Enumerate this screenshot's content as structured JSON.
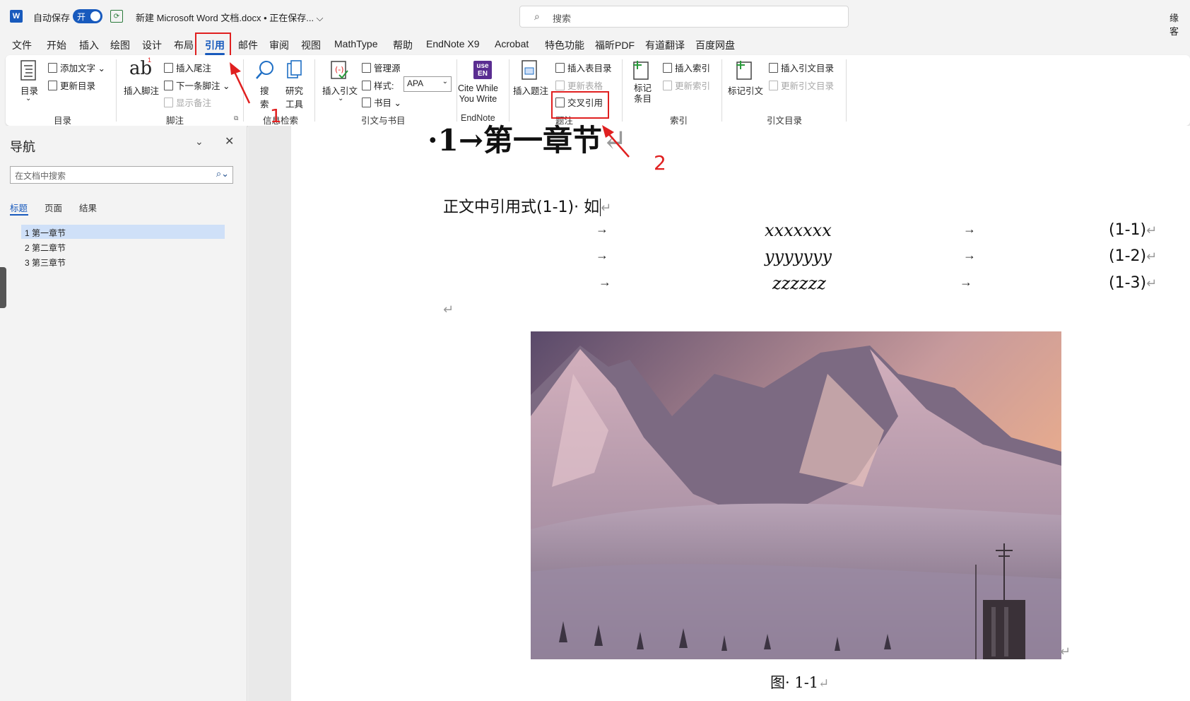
{
  "titlebar": {
    "app_logo": "W",
    "autosave_label": "自动保存",
    "autosave_state": "开",
    "doc_title": "新建 Microsoft Word 文档.docx • 正在保存... ⌵",
    "search_placeholder": "搜索",
    "user": "缘 客"
  },
  "menu_tabs": [
    "文件",
    "开始",
    "插入",
    "绘图",
    "设计",
    "布局",
    "引用",
    "邮件",
    "审阅",
    "视图",
    "MathType",
    "帮助",
    "EndNote X9",
    "Acrobat",
    "特色功能",
    "福昕PDF",
    "有道翻译",
    "百度网盘"
  ],
  "active_tab": "引用",
  "ribbon": {
    "toc": {
      "big": "目录",
      "add_text": "添加文字",
      "update_toc": "更新目录",
      "group": "目录"
    },
    "footnote": {
      "insert_footnote": "插入脚注",
      "ab_glyph": "ab",
      "insert_endnote": "插入尾注",
      "next_footnote": "下一条脚注",
      "show_notes": "显示备注",
      "group": "脚注"
    },
    "research": {
      "search_l1": "搜",
      "search_l2": "索",
      "research_l1": "研究",
      "research_l2": "工具",
      "group": "信息检索"
    },
    "citations": {
      "insert_citation": "插入引文",
      "manage_sources": "管理源",
      "style_label": "样式:",
      "style_value": "APA",
      "bibliography": "书目",
      "group": "引文与书目"
    },
    "endnote": {
      "logo_line1": "use",
      "logo_line2": "EN",
      "cite_l1": "Cite While",
      "cite_l2": "You Write",
      "group": "EndNote"
    },
    "captions": {
      "insert_caption": "插入题注",
      "insert_table_of_figures": "插入表目录",
      "update_table": "更新表格",
      "cross_reference": "交叉引用",
      "group": "题注"
    },
    "index": {
      "mark_entry_l1": "标记",
      "mark_entry_l2": "条目",
      "insert_index": "插入索引",
      "update_index": "更新索引",
      "group": "索引"
    },
    "toa": {
      "mark_citation": "标记引文",
      "insert_toa": "插入引文目录",
      "update_toa": "更新引文目录",
      "group": "引文目录"
    }
  },
  "navigation": {
    "title": "导航",
    "search_placeholder": "在文档中搜索",
    "tabs": [
      "标题",
      "页面",
      "结果"
    ],
    "items": [
      "1 第一章节",
      "2 第二章节",
      "3 第三章节"
    ]
  },
  "document": {
    "heading_prefix": "·1→",
    "heading_text": "第一章节",
    "para_mark": "↵",
    "body_text": "正文中引用式(1-1)· 如",
    "tab_arrow": "→",
    "equations": [
      {
        "expr": "xxxxxxx",
        "num": "(1-1)"
      },
      {
        "expr": "yyyyyyy",
        "num": "(1-2)"
      },
      {
        "expr": "zzzzzz",
        "num": "(1-3)"
      }
    ],
    "figure_caption": "图· 1-1"
  },
  "annotations": {
    "step1": "1",
    "step2": "2"
  },
  "colors": {
    "accent": "#185abd",
    "annotation": "#e02020",
    "endnote": "#5a2d91"
  }
}
